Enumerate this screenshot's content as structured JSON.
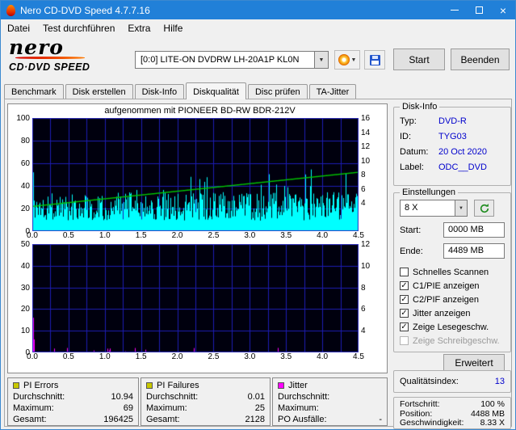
{
  "window": {
    "title": "Nero CD-DVD Speed 4.7.7.16"
  },
  "icons": {
    "dropdown": "▼",
    "close": "×"
  },
  "menu": {
    "items": [
      "Datei",
      "Test durchführen",
      "Extra",
      "Hilfe"
    ]
  },
  "logo": {
    "name": "nero",
    "product": "CD·DVD SPEED"
  },
  "toolbar": {
    "drive": "[0:0]  LITE-ON DVDRW LH-20A1P KL0N",
    "start": "Start",
    "quit": "Beenden"
  },
  "tabs": {
    "items": [
      {
        "label": "Benchmark",
        "active": false
      },
      {
        "label": "Disk erstellen",
        "active": false
      },
      {
        "label": "Disk-Info",
        "active": false
      },
      {
        "label": "Diskqualität",
        "active": true
      },
      {
        "label": "Disc prüfen",
        "active": false
      },
      {
        "label": "TA-Jitter",
        "active": false
      }
    ]
  },
  "recorded_with": "aufgenommen mit PIONEER  BD-RW   BDR-212V",
  "disk_info": {
    "title": "Disk-Info",
    "rows": [
      {
        "label": "Typ:",
        "value": "DVD-R"
      },
      {
        "label": "ID:",
        "value": "TYG03"
      },
      {
        "label": "Datum:",
        "value": "20 Oct 2020"
      },
      {
        "label": "Label:",
        "value": "ODC__DVD"
      }
    ]
  },
  "settings": {
    "title": "Einstellungen",
    "speed": "8 X",
    "start_label": "Start:",
    "start_value": "0000 MB",
    "end_label": "Ende:",
    "end_value": "4489 MB",
    "checkboxes": [
      {
        "label": "Schnelles Scannen",
        "checked": false,
        "disabled": false
      },
      {
        "label": "C1/PIE anzeigen",
        "checked": true,
        "disabled": false
      },
      {
        "label": "C2/PIF anzeigen",
        "checked": true,
        "disabled": false
      },
      {
        "label": "Jitter anzeigen",
        "checked": true,
        "disabled": false
      },
      {
        "label": "Zeige Lesegeschw.",
        "checked": true,
        "disabled": false
      },
      {
        "label": "Zeige Schreibgeschw.",
        "checked": false,
        "disabled": true
      }
    ],
    "advanced": "Erweitert"
  },
  "quality": {
    "label": "Qualitätsindex:",
    "value": "13"
  },
  "progress": {
    "rows": [
      {
        "label": "Fortschritt:",
        "value": "100 %"
      },
      {
        "label": "Position:",
        "value": "4488 MB"
      },
      {
        "label": "Geschwindigkeit:",
        "value": "8.33 X"
      }
    ]
  },
  "stats": {
    "panels": [
      {
        "title": "PI Errors",
        "color": "#c8c800",
        "rows": [
          {
            "label": "Durchschnitt:",
            "value": "10.94"
          },
          {
            "label": "Maximum:",
            "value": "69"
          },
          {
            "label": "Gesamt:",
            "value": "196425"
          }
        ]
      },
      {
        "title": "PI Failures",
        "color": "#c8c800",
        "rows": [
          {
            "label": "Durchschnitt:",
            "value": "0.01"
          },
          {
            "label": "Maximum:",
            "value": "25"
          },
          {
            "label": "Gesamt:",
            "value": "2128"
          }
        ]
      },
      {
        "title": "Jitter",
        "color": "#ff00ff",
        "rows": [
          {
            "label": "Durchschnitt:",
            "value": ""
          },
          {
            "label": "Maximum:",
            "value": ""
          },
          {
            "label": "PO Ausfälle:",
            "value": "-"
          }
        ]
      }
    ]
  },
  "chart_data": [
    {
      "type": "area",
      "name": "pi-errors-scan",
      "bg": "#00000e",
      "grid_color": "#1c1cb4",
      "border_color": "#3434c8",
      "x": {
        "range": [
          0,
          4.5
        ],
        "grid_step": 0.25,
        "ticks": [
          "0.0",
          "0.5",
          "1.0",
          "1.5",
          "2.0",
          "2.5",
          "3.0",
          "3.5",
          "4.0",
          "4.5"
        ]
      },
      "y_left": {
        "range": [
          0,
          100
        ],
        "grid_step": 20,
        "ticks": [
          100,
          80,
          60,
          40,
          20,
          0
        ]
      },
      "y_right": {
        "range": [
          0,
          16
        ],
        "ticks": [
          16,
          14,
          12,
          10,
          8,
          6,
          4
        ]
      },
      "series": [
        {
          "name": "PI Errors",
          "type": "spikes",
          "axis": "left",
          "color": "#00ffff",
          "avg": 10.94,
          "max": 69,
          "total": 196425,
          "seed": 1337,
          "initial": [
            69,
            52,
            27,
            12
          ]
        },
        {
          "name": "Lesegeschwindigkeit",
          "type": "line",
          "axis": "right",
          "color": "#00c800",
          "start": 3.5,
          "end": 8.33
        }
      ]
    },
    {
      "type": "area",
      "name": "pi-failures-scan",
      "bg": "#00000e",
      "grid_color": "#1c1cb4",
      "border_color": "#3434c8",
      "x": {
        "range": [
          0,
          4.5
        ],
        "grid_step": 0.25,
        "ticks": [
          "0.0",
          "0.5",
          "1.0",
          "1.5",
          "2.0",
          "2.5",
          "3.0",
          "3.5",
          "4.0",
          "4.5"
        ]
      },
      "y_left": {
        "range": [
          0,
          50
        ],
        "grid_step": 10,
        "ticks": [
          50,
          40,
          30,
          20,
          10,
          0
        ]
      },
      "y_right": {
        "range": [
          2,
          12
        ],
        "ticks": [
          12,
          10,
          8,
          6,
          4
        ]
      },
      "series": [
        {
          "name": "PI Failures",
          "type": "spikes",
          "axis": "left",
          "color": "#ff00ff",
          "avg": 0.01,
          "max": 25,
          "total": 2128,
          "seed": 77,
          "sparse": true,
          "initial": [
            36,
            16,
            6
          ]
        }
      ]
    }
  ]
}
